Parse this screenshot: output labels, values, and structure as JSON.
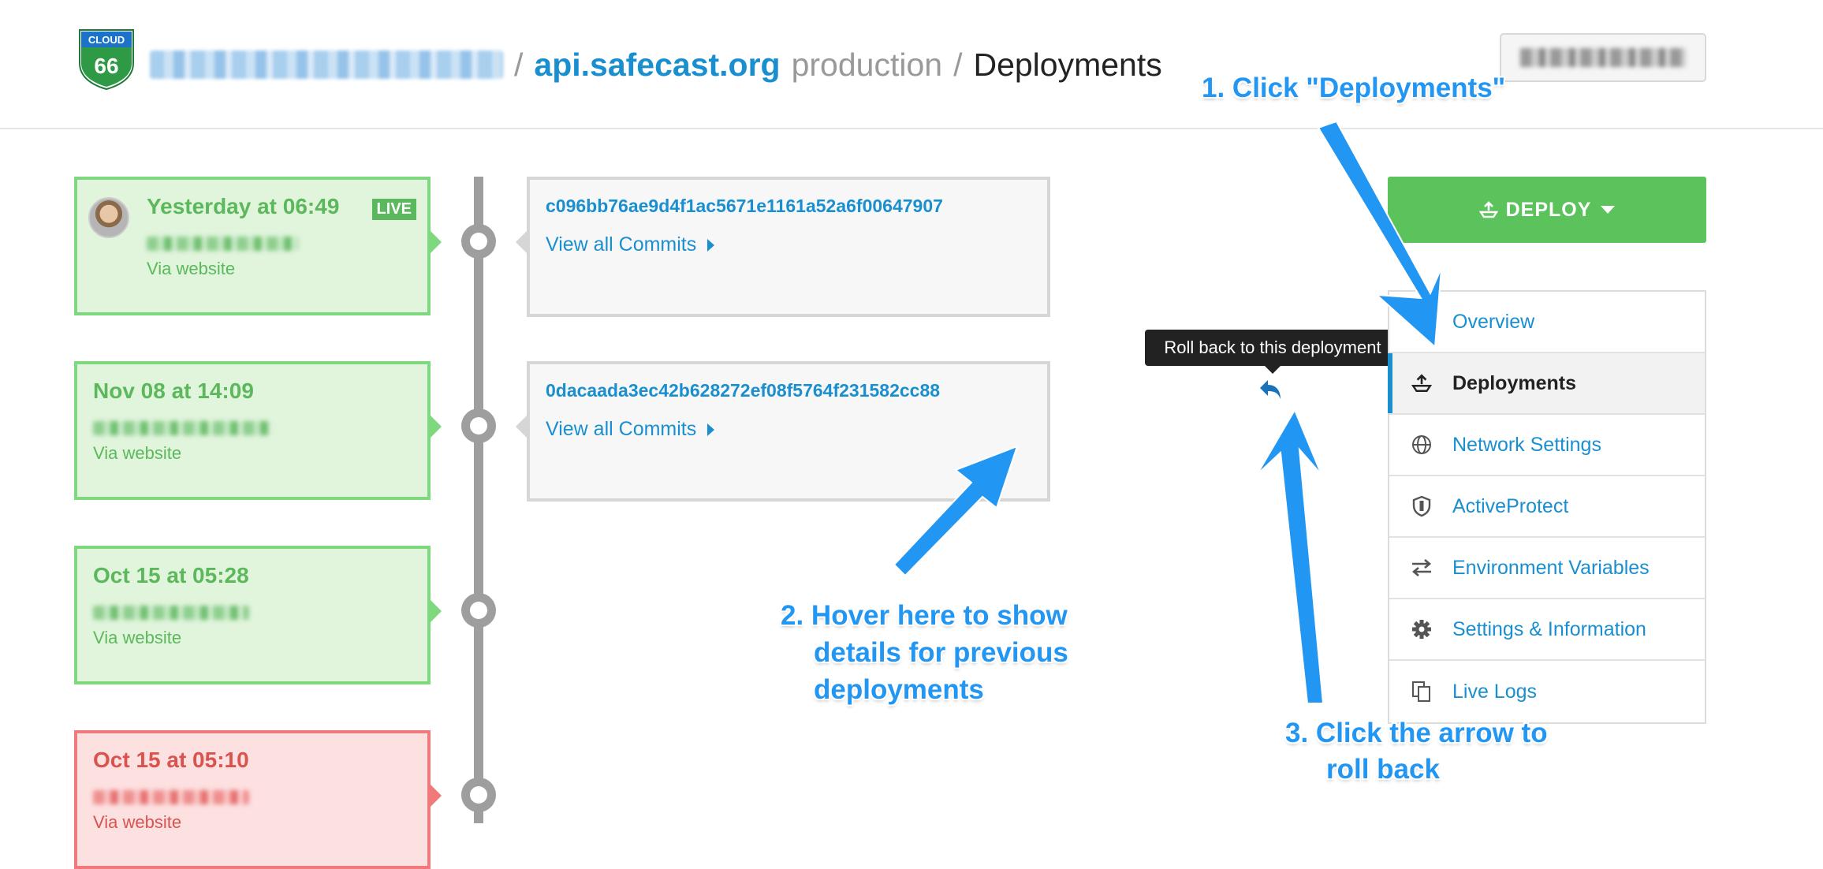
{
  "header": {
    "logo_top": "CLOUD",
    "logo_number": "66",
    "breadcrumb_separator": "/",
    "app_name": "api.safecast.org",
    "environment": "production",
    "current_page": "Deployments"
  },
  "deployments": [
    {
      "date": "Yesterday at 06:49",
      "via": "Via website",
      "live_label": "LIVE",
      "status": "success"
    },
    {
      "date": "Nov 08 at 14:09",
      "via": "Via website",
      "status": "success"
    },
    {
      "date": "Oct 15 at 05:28",
      "via": "Via website",
      "status": "success"
    },
    {
      "date": "Oct 15 at 05:10",
      "via": "Via website",
      "status": "failed"
    }
  ],
  "commits": [
    {
      "hash": "c096bb76ae9d4f1ac5671e1161a52a6f00647907",
      "view_label": "View all Commits"
    },
    {
      "hash": "0dacaada3ec42b628272ef08f5764f231582cc88",
      "view_label": "View all Commits"
    }
  ],
  "tooltip": "Roll back to this deployment",
  "deploy_button": "DEPLOY",
  "menu": [
    {
      "label": "Overview",
      "icon": "overview-icon"
    },
    {
      "label": "Deployments",
      "icon": "deploy-icon",
      "active": true
    },
    {
      "label": "Network Settings",
      "icon": "globe-icon"
    },
    {
      "label": "ActiveProtect",
      "icon": "shield-icon"
    },
    {
      "label": "Environment Variables",
      "icon": "swap-arrows-icon"
    },
    {
      "label": "Settings & Information",
      "icon": "gear-icon"
    },
    {
      "label": "Live Logs",
      "icon": "copy-icon"
    }
  ],
  "annotations": {
    "step1": "1. Click \"Deployments\"",
    "step2_line1": "2. Hover here to show",
    "step2_line2": "details for previous",
    "step2_line3": "deployments",
    "step3_line1": "3. Click the arrow to",
    "step3_line2": "roll back"
  },
  "colors": {
    "accent": "#1a8fd0",
    "success": "#5cc25c",
    "failed": "#f07a7a",
    "annotation": "#2196f3"
  }
}
